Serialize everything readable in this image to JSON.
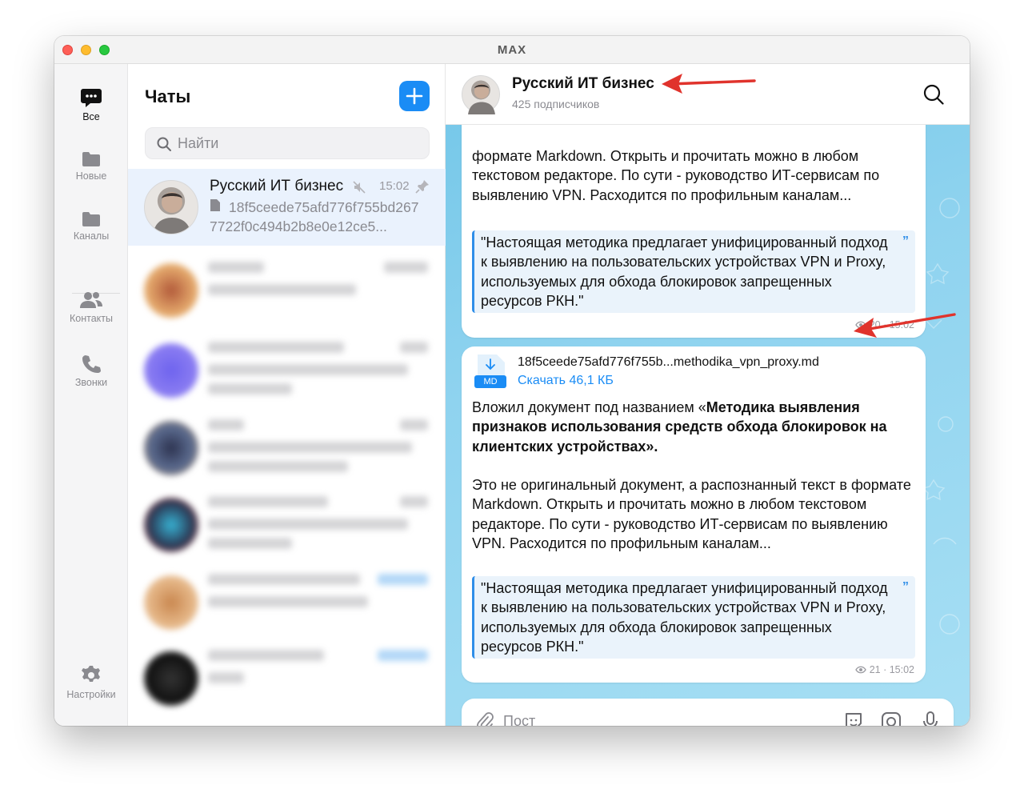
{
  "window": {
    "title": "MAX"
  },
  "nav": {
    "items": [
      {
        "label": "Все",
        "icon": "chat-bubble-icon",
        "active": true
      },
      {
        "label": "Новые",
        "icon": "folder-icon"
      },
      {
        "label": "Каналы",
        "icon": "folder-icon"
      },
      {
        "label": "Контакты",
        "icon": "contacts-icon"
      },
      {
        "label": "Звонки",
        "icon": "phone-icon"
      }
    ],
    "settings_label": "Настройки"
  },
  "list": {
    "title": "Чаты",
    "search_placeholder": "Найти",
    "active_chat": {
      "name": "Русский ИТ бизнес",
      "time": "15:02",
      "preview": "18f5ceede75afd776f755bd2677722f0c494b2b8e0e12ce5..."
    }
  },
  "conversation": {
    "title": "Русский ИТ бизнес",
    "subtitle": "425 подписчиков",
    "message1": {
      "text": "формате Markdown. Открыть и прочитать можно в любом текстовом редакторе. По сути - руководство ИТ-сервисам по выявлению VPN. Расходится по профильным каналам...",
      "quote": "\"Настоящая методика предлагает унифицированный подход к выявлению на пользовательских устройствах VPN и Proxy, используемых для обхода блокировок запрещенных ресурсов РКН.\"",
      "views": "20",
      "time": "15:02"
    },
    "message2": {
      "file_ext": "MD",
      "file_name": "18f5ceede75afd776f755b...methodika_vpn_proxy.md",
      "download_label": "Скачать 46,1 КБ",
      "intro_prefix": "Вложил документ под названием «",
      "intro_bold": "Методика выявления признаков использования средств обхода блокировок на клиентских устройствах",
      "intro_suffix": "».",
      "text": "Это не оригинальный документ, а распознанный текст в формате Markdown. Открыть и прочитать можно в любом текстовом редакторе. По сути - руководство ИТ-сервисам по выявлению VPN. Расходится по профильным каналам...",
      "quote": "\"Настоящая методика предлагает унифицированный подход к выявлению на пользовательских устройствах VPN и Proxy, используемых для обхода блокировок запрещенных ресурсов РКН.\"",
      "views": "21",
      "time": "15:02"
    },
    "composer_placeholder": "Пост"
  },
  "colors": {
    "accent": "#1a8cf5",
    "annotation": "#e0332c"
  }
}
